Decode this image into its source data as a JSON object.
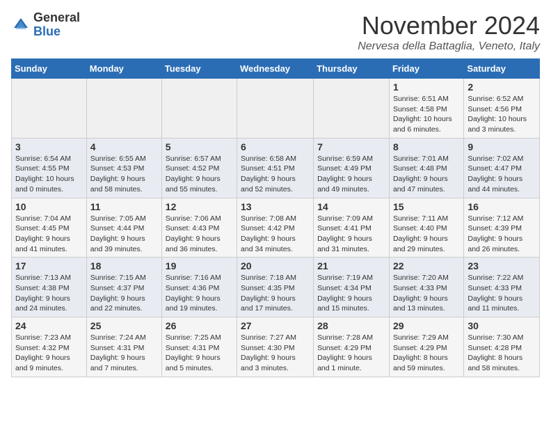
{
  "logo": {
    "general": "General",
    "blue": "Blue"
  },
  "header": {
    "month": "November 2024",
    "location": "Nervesa della Battaglia, Veneto, Italy"
  },
  "weekdays": [
    "Sunday",
    "Monday",
    "Tuesday",
    "Wednesday",
    "Thursday",
    "Friday",
    "Saturday"
  ],
  "weeks": [
    [
      {
        "day": "",
        "info": ""
      },
      {
        "day": "",
        "info": ""
      },
      {
        "day": "",
        "info": ""
      },
      {
        "day": "",
        "info": ""
      },
      {
        "day": "",
        "info": ""
      },
      {
        "day": "1",
        "info": "Sunrise: 6:51 AM\nSunset: 4:58 PM\nDaylight: 10 hours and 6 minutes."
      },
      {
        "day": "2",
        "info": "Sunrise: 6:52 AM\nSunset: 4:56 PM\nDaylight: 10 hours and 3 minutes."
      }
    ],
    [
      {
        "day": "3",
        "info": "Sunrise: 6:54 AM\nSunset: 4:55 PM\nDaylight: 10 hours and 0 minutes."
      },
      {
        "day": "4",
        "info": "Sunrise: 6:55 AM\nSunset: 4:53 PM\nDaylight: 9 hours and 58 minutes."
      },
      {
        "day": "5",
        "info": "Sunrise: 6:57 AM\nSunset: 4:52 PM\nDaylight: 9 hours and 55 minutes."
      },
      {
        "day": "6",
        "info": "Sunrise: 6:58 AM\nSunset: 4:51 PM\nDaylight: 9 hours and 52 minutes."
      },
      {
        "day": "7",
        "info": "Sunrise: 6:59 AM\nSunset: 4:49 PM\nDaylight: 9 hours and 49 minutes."
      },
      {
        "day": "8",
        "info": "Sunrise: 7:01 AM\nSunset: 4:48 PM\nDaylight: 9 hours and 47 minutes."
      },
      {
        "day": "9",
        "info": "Sunrise: 7:02 AM\nSunset: 4:47 PM\nDaylight: 9 hours and 44 minutes."
      }
    ],
    [
      {
        "day": "10",
        "info": "Sunrise: 7:04 AM\nSunset: 4:45 PM\nDaylight: 9 hours and 41 minutes."
      },
      {
        "day": "11",
        "info": "Sunrise: 7:05 AM\nSunset: 4:44 PM\nDaylight: 9 hours and 39 minutes."
      },
      {
        "day": "12",
        "info": "Sunrise: 7:06 AM\nSunset: 4:43 PM\nDaylight: 9 hours and 36 minutes."
      },
      {
        "day": "13",
        "info": "Sunrise: 7:08 AM\nSunset: 4:42 PM\nDaylight: 9 hours and 34 minutes."
      },
      {
        "day": "14",
        "info": "Sunrise: 7:09 AM\nSunset: 4:41 PM\nDaylight: 9 hours and 31 minutes."
      },
      {
        "day": "15",
        "info": "Sunrise: 7:11 AM\nSunset: 4:40 PM\nDaylight: 9 hours and 29 minutes."
      },
      {
        "day": "16",
        "info": "Sunrise: 7:12 AM\nSunset: 4:39 PM\nDaylight: 9 hours and 26 minutes."
      }
    ],
    [
      {
        "day": "17",
        "info": "Sunrise: 7:13 AM\nSunset: 4:38 PM\nDaylight: 9 hours and 24 minutes."
      },
      {
        "day": "18",
        "info": "Sunrise: 7:15 AM\nSunset: 4:37 PM\nDaylight: 9 hours and 22 minutes."
      },
      {
        "day": "19",
        "info": "Sunrise: 7:16 AM\nSunset: 4:36 PM\nDaylight: 9 hours and 19 minutes."
      },
      {
        "day": "20",
        "info": "Sunrise: 7:18 AM\nSunset: 4:35 PM\nDaylight: 9 hours and 17 minutes."
      },
      {
        "day": "21",
        "info": "Sunrise: 7:19 AM\nSunset: 4:34 PM\nDaylight: 9 hours and 15 minutes."
      },
      {
        "day": "22",
        "info": "Sunrise: 7:20 AM\nSunset: 4:33 PM\nDaylight: 9 hours and 13 minutes."
      },
      {
        "day": "23",
        "info": "Sunrise: 7:22 AM\nSunset: 4:33 PM\nDaylight: 9 hours and 11 minutes."
      }
    ],
    [
      {
        "day": "24",
        "info": "Sunrise: 7:23 AM\nSunset: 4:32 PM\nDaylight: 9 hours and 9 minutes."
      },
      {
        "day": "25",
        "info": "Sunrise: 7:24 AM\nSunset: 4:31 PM\nDaylight: 9 hours and 7 minutes."
      },
      {
        "day": "26",
        "info": "Sunrise: 7:25 AM\nSunset: 4:31 PM\nDaylight: 9 hours and 5 minutes."
      },
      {
        "day": "27",
        "info": "Sunrise: 7:27 AM\nSunset: 4:30 PM\nDaylight: 9 hours and 3 minutes."
      },
      {
        "day": "28",
        "info": "Sunrise: 7:28 AM\nSunset: 4:29 PM\nDaylight: 9 hours and 1 minute."
      },
      {
        "day": "29",
        "info": "Sunrise: 7:29 AM\nSunset: 4:29 PM\nDaylight: 8 hours and 59 minutes."
      },
      {
        "day": "30",
        "info": "Sunrise: 7:30 AM\nSunset: 4:28 PM\nDaylight: 8 hours and 58 minutes."
      }
    ]
  ]
}
